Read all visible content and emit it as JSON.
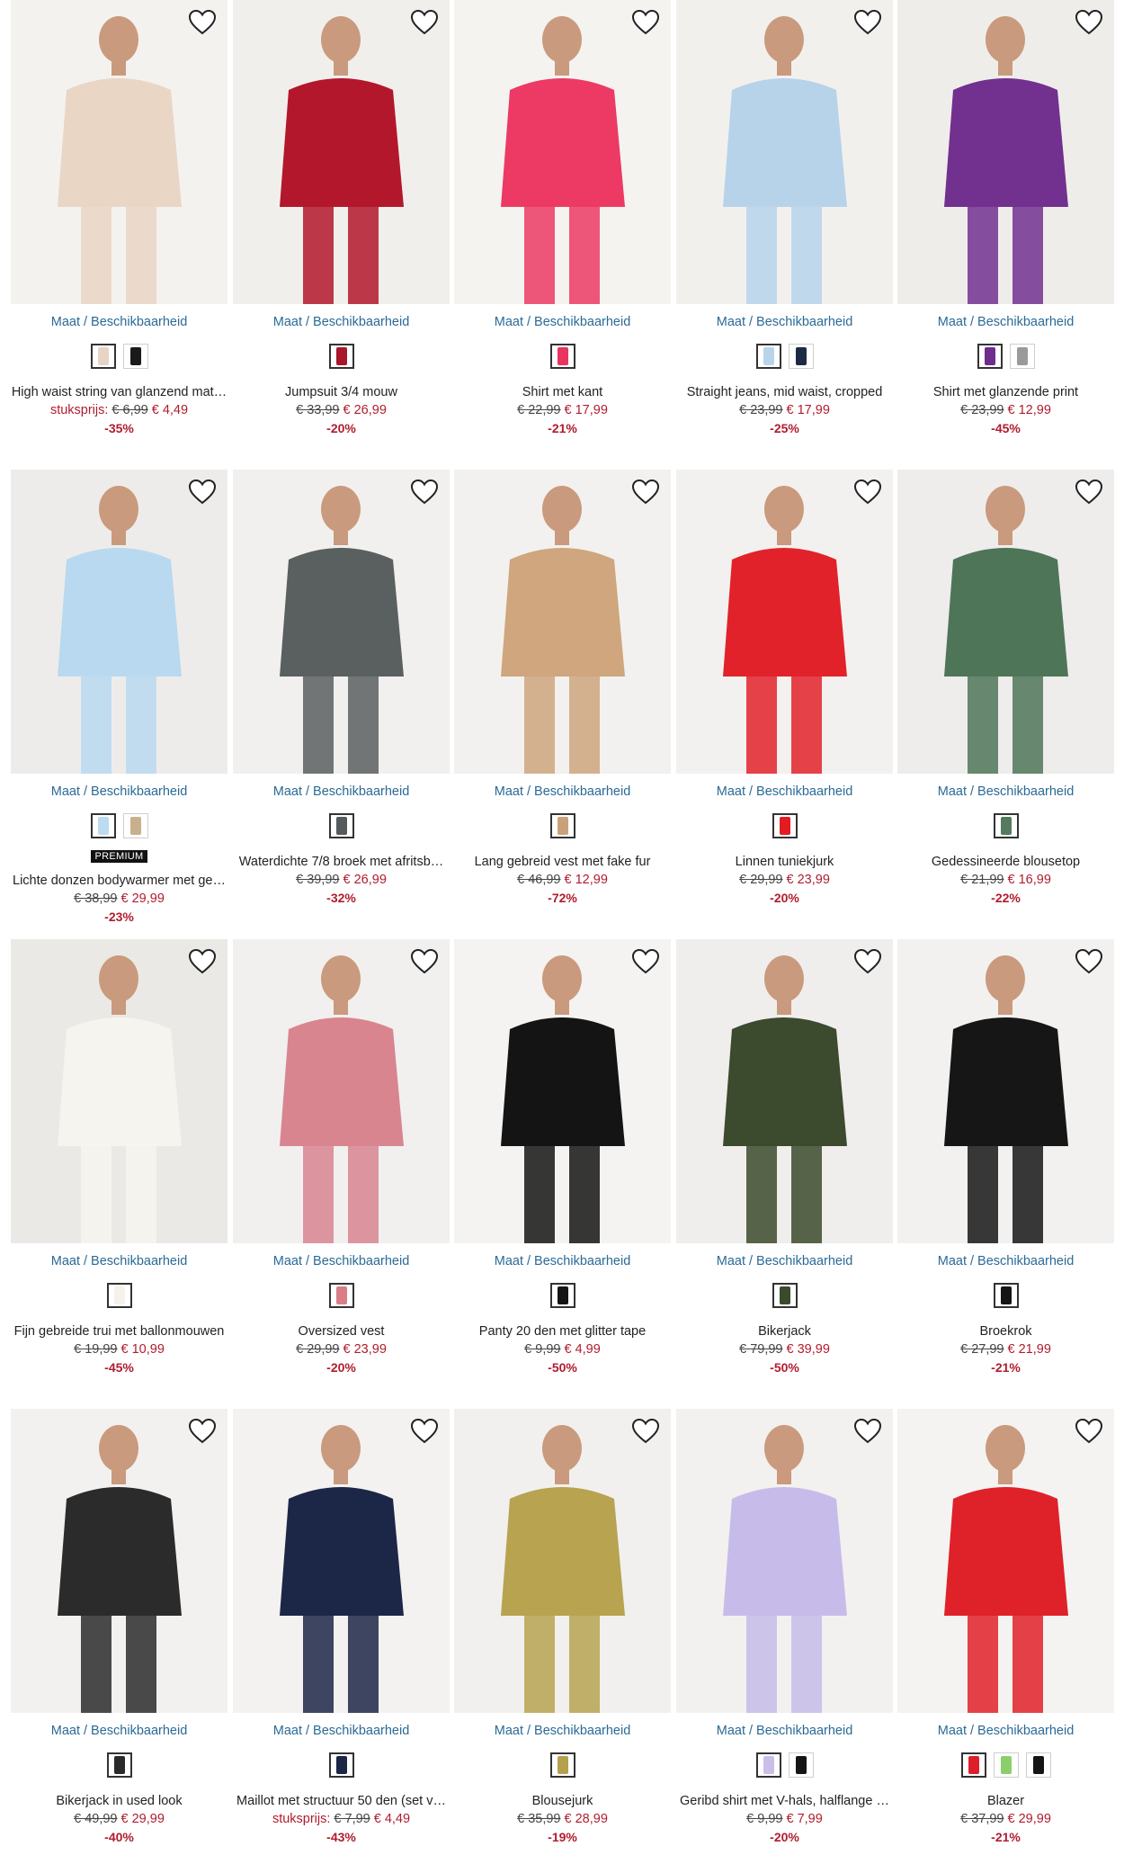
{
  "common": {
    "size_availability_label": "Maat / Beschikbaarheid"
  },
  "rows": [
    {
      "products": [
        {
          "title": "High waist string van glanzend mat…",
          "unit_label": "stuksprijs:",
          "old_price": "€ 6,99",
          "new_price": "€ 4,49",
          "discount": "-35%",
          "swatches": [
            "#e8d4c4",
            "#1a1a1a"
          ],
          "badge": "",
          "image_color": "#e9d6c5",
          "bg": "#f4f2ef"
        },
        {
          "title": "Jumpsuit 3/4 mouw",
          "unit_label": "",
          "old_price": "€ 33,99",
          "new_price": "€ 26,99",
          "discount": "-20%",
          "swatches": [
            "#a8172a"
          ],
          "badge": "",
          "image_color": "#b3172b",
          "bg": "#f1efec"
        },
        {
          "title": "Shirt met kant",
          "unit_label": "",
          "old_price": "€ 22,99",
          "new_price": "€ 17,99",
          "discount": "-21%",
          "swatches": [
            "#e8345e"
          ],
          "badge": "",
          "image_color": "#ec3a64",
          "bg": "#f4f3f0"
        },
        {
          "title": "Straight jeans, mid waist, cropped",
          "unit_label": "",
          "old_price": "€ 23,99",
          "new_price": "€ 17,99",
          "discount": "-25%",
          "swatches": [
            "#b9d4e8",
            "#1d2a44"
          ],
          "badge": "",
          "image_color": "#b7d3ea",
          "bg": "#f2f0ed"
        },
        {
          "title": "Shirt met glanzende print",
          "unit_label": "",
          "old_price": "€ 23,99",
          "new_price": "€ 12,99",
          "discount": "-45%",
          "swatches": [
            "#6e2c8e",
            "#9a9a9a"
          ],
          "badge": "",
          "image_color": "#72308f",
          "bg": "#efedea"
        }
      ]
    },
    {
      "products": [
        {
          "title": "Lichte donzen bodywarmer met ge…",
          "unit_label": "",
          "old_price": "€ 38,99",
          "new_price": "€ 29,99",
          "discount": "-23%",
          "swatches": [
            "#bcdaf0",
            "#c9b08c"
          ],
          "badge": "PREMIUM",
          "image_color": "#b9d9f0",
          "bg": "#eeecea"
        },
        {
          "title": "Waterdichte 7/8 broek met afritsb…",
          "unit_label": "",
          "old_price": "€ 39,99",
          "new_price": "€ 26,99",
          "discount": "-32%",
          "swatches": [
            "#555a5c"
          ],
          "badge": "",
          "image_color": "#5a5f60",
          "bg": "#f1f0ee"
        },
        {
          "title": "Lang gebreid vest met fake fur",
          "unit_label": "",
          "old_price": "€ 46,99",
          "new_price": "€ 12,99",
          "discount": "-72%",
          "swatches": [
            "#caa27a"
          ],
          "badge": "",
          "image_color": "#cfa67d",
          "bg": "#f2f1ef"
        },
        {
          "title": "Linnen tuniekjurk",
          "unit_label": "",
          "old_price": "€ 29,99",
          "new_price": "€ 23,99",
          "discount": "-20%",
          "swatches": [
            "#e31c24"
          ],
          "badge": "",
          "image_color": "#e2222a",
          "bg": "#f3f1ef"
        },
        {
          "title": "Gedessineerde blousetop",
          "unit_label": "",
          "old_price": "€ 21,99",
          "new_price": "€ 16,99",
          "discount": "-22%",
          "swatches": [
            "#557a5e"
          ],
          "badge": "",
          "image_color": "#4f7558",
          "bg": "#eeedeb"
        }
      ]
    },
    {
      "products": [
        {
          "title": "Fijn gebreide trui met ballonmouwen",
          "unit_label": "",
          "old_price": "€ 19,99",
          "new_price": "€ 10,99",
          "discount": "-45%",
          "swatches": [
            "#f4f2ea"
          ],
          "badge": "",
          "image_color": "#f6f4ee",
          "bg": "#ebe9e6"
        },
        {
          "title": "Oversized vest",
          "unit_label": "",
          "old_price": "€ 29,99",
          "new_price": "€ 23,99",
          "discount": "-20%",
          "swatches": [
            "#d97e88"
          ],
          "badge": "",
          "image_color": "#d88590",
          "bg": "#f1f0ee"
        },
        {
          "title": "Panty 20 den met glitter tape",
          "unit_label": "",
          "old_price": "€ 9,99",
          "new_price": "€ 4,99",
          "discount": "-50%",
          "swatches": [
            "#151515"
          ],
          "badge": "",
          "image_color": "#141414",
          "bg": "#f4f3f1"
        },
        {
          "title": "Bikerjack",
          "unit_label": "",
          "old_price": "€ 79,99",
          "new_price": "€ 39,99",
          "discount": "-50%",
          "swatches": [
            "#3b4a2c"
          ],
          "badge": "",
          "image_color": "#3c4a2d",
          "bg": "#efeeec"
        },
        {
          "title": "Broekrok",
          "unit_label": "",
          "old_price": "€ 27,99",
          "new_price": "€ 21,99",
          "discount": "-21%",
          "swatches": [
            "#151515"
          ],
          "badge": "",
          "image_color": "#161616",
          "bg": "#f2f1ef"
        }
      ]
    },
    {
      "products": [
        {
          "title": "Bikerjack in used look",
          "unit_label": "",
          "old_price": "€ 49,99",
          "new_price": "€ 29,99",
          "discount": "-40%",
          "swatches": [
            "#2a2a2a"
          ],
          "badge": "",
          "image_color": "#2b2b2b",
          "bg": "#f2f1ef"
        },
        {
          "title": "Maillot met structuur 50 den (set v…",
          "unit_label": "stuksprijs:",
          "old_price": "€ 7,99",
          "new_price": "€ 4,49",
          "discount": "-43%",
          "swatches": [
            "#1c2746"
          ],
          "badge": "",
          "image_color": "#1c2748",
          "bg": "#f3f2f0"
        },
        {
          "title": "Blousejurk",
          "unit_label": "",
          "old_price": "€ 35,99",
          "new_price": "€ 28,99",
          "discount": "-19%",
          "swatches": [
            "#b5a04e"
          ],
          "badge": "",
          "image_color": "#b7a350",
          "bg": "#f1f0ee"
        },
        {
          "title": "Geribd shirt met V-hals, halflange …",
          "unit_label": "",
          "old_price": "€ 9,99",
          "new_price": "€ 7,99",
          "discount": "-20%",
          "swatches": [
            "#c9bfe8",
            "#151515"
          ],
          "badge": "",
          "image_color": "#c7bce9",
          "bg": "#f2f1ef"
        },
        {
          "title": "Blazer",
          "unit_label": "",
          "old_price": "€ 37,99",
          "new_price": "€ 29,99",
          "discount": "-21%",
          "swatches": [
            "#dd1f2a",
            "#8ccf6a",
            "#151515"
          ],
          "badge": "",
          "image_color": "#df2129",
          "bg": "#f4f3f1"
        }
      ]
    }
  ]
}
